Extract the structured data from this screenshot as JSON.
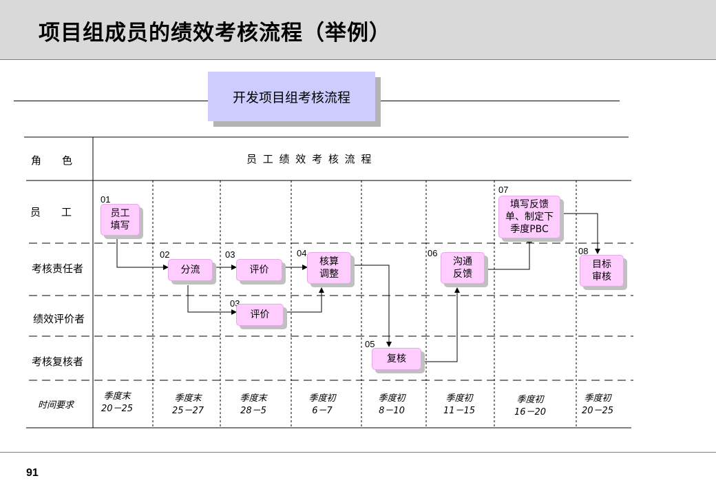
{
  "header": {
    "title": "项目组成员的绩效考核流程（举例）"
  },
  "subtitle": "开发项目组考核流程",
  "table": {
    "role_header": "角　　色",
    "process_header": "员 工 绩 效 考 核 流 程",
    "roles": [
      "员　　工",
      "考核责任者",
      "绩效评价者",
      "考核复核者"
    ],
    "time_label": "时间要求"
  },
  "steps": [
    {
      "num": "01",
      "label": "员工\n填写"
    },
    {
      "num": "02",
      "label": "分流"
    },
    {
      "num": "03",
      "label": "评价"
    },
    {
      "num": "03",
      "label": "评价"
    },
    {
      "num": "04",
      "label": "核算\n调整"
    },
    {
      "num": "05",
      "label": "复核"
    },
    {
      "num": "06",
      "label": "沟通\n反馈"
    },
    {
      "num": "07",
      "label": "填写反馈\n单、制定下\n季度PBC"
    },
    {
      "num": "08",
      "label": "目标\n审核"
    }
  ],
  "times": [
    "季度末\n20－25",
    "季度末\n25－27",
    "季度末\n28－5",
    "季度初\n6－7",
    "季度初\n8－10",
    "季度初\n11－15",
    "季度初\n16－20",
    "季度初\n20－25"
  ],
  "page_number": "91",
  "colors": {
    "header_bg": "#d9d9d9",
    "subtitle_bg": "#ccccff",
    "box_bg": "#ffccff"
  }
}
